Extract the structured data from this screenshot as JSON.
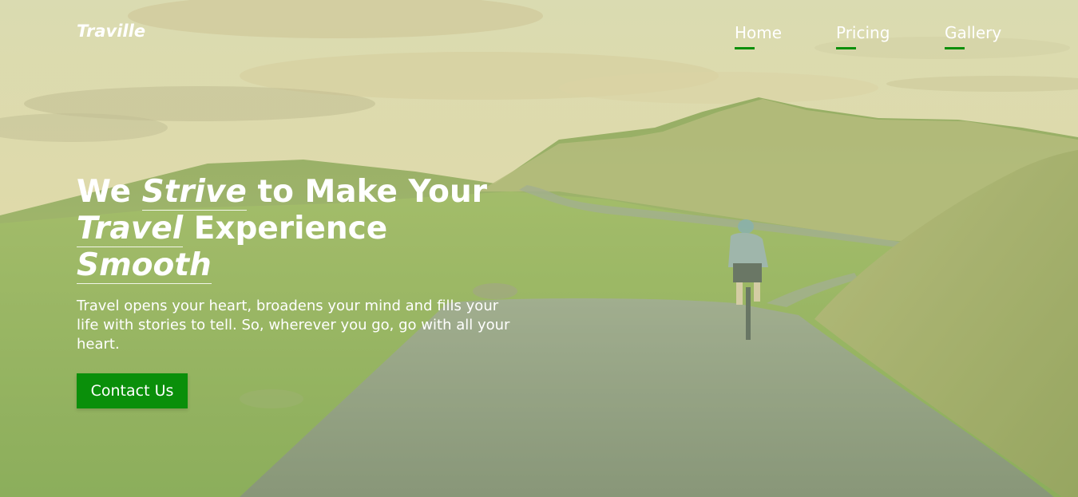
{
  "brand": {
    "name": "Traville"
  },
  "nav": {
    "items": [
      {
        "label": "Home"
      },
      {
        "label": "Pricing"
      },
      {
        "label": "Gallery"
      }
    ]
  },
  "hero": {
    "headline": {
      "part1": "We ",
      "emphasis1": "Strive",
      "part2": " to Make Your ",
      "emphasis2": "Travel",
      "part3": " Experience ",
      "emphasis3": "Smooth"
    },
    "tagline": "Travel opens your heart, broadens your mind and fills your life with stories to tell. So, wherever you go, go with all your heart.",
    "cta_label": "Contact Us"
  },
  "colors": {
    "accent": "#0a8f0a",
    "text": "#ffffff",
    "overlay": "#c8d89a"
  },
  "background": {
    "description_icon": "landscape-cyclist-photo"
  }
}
